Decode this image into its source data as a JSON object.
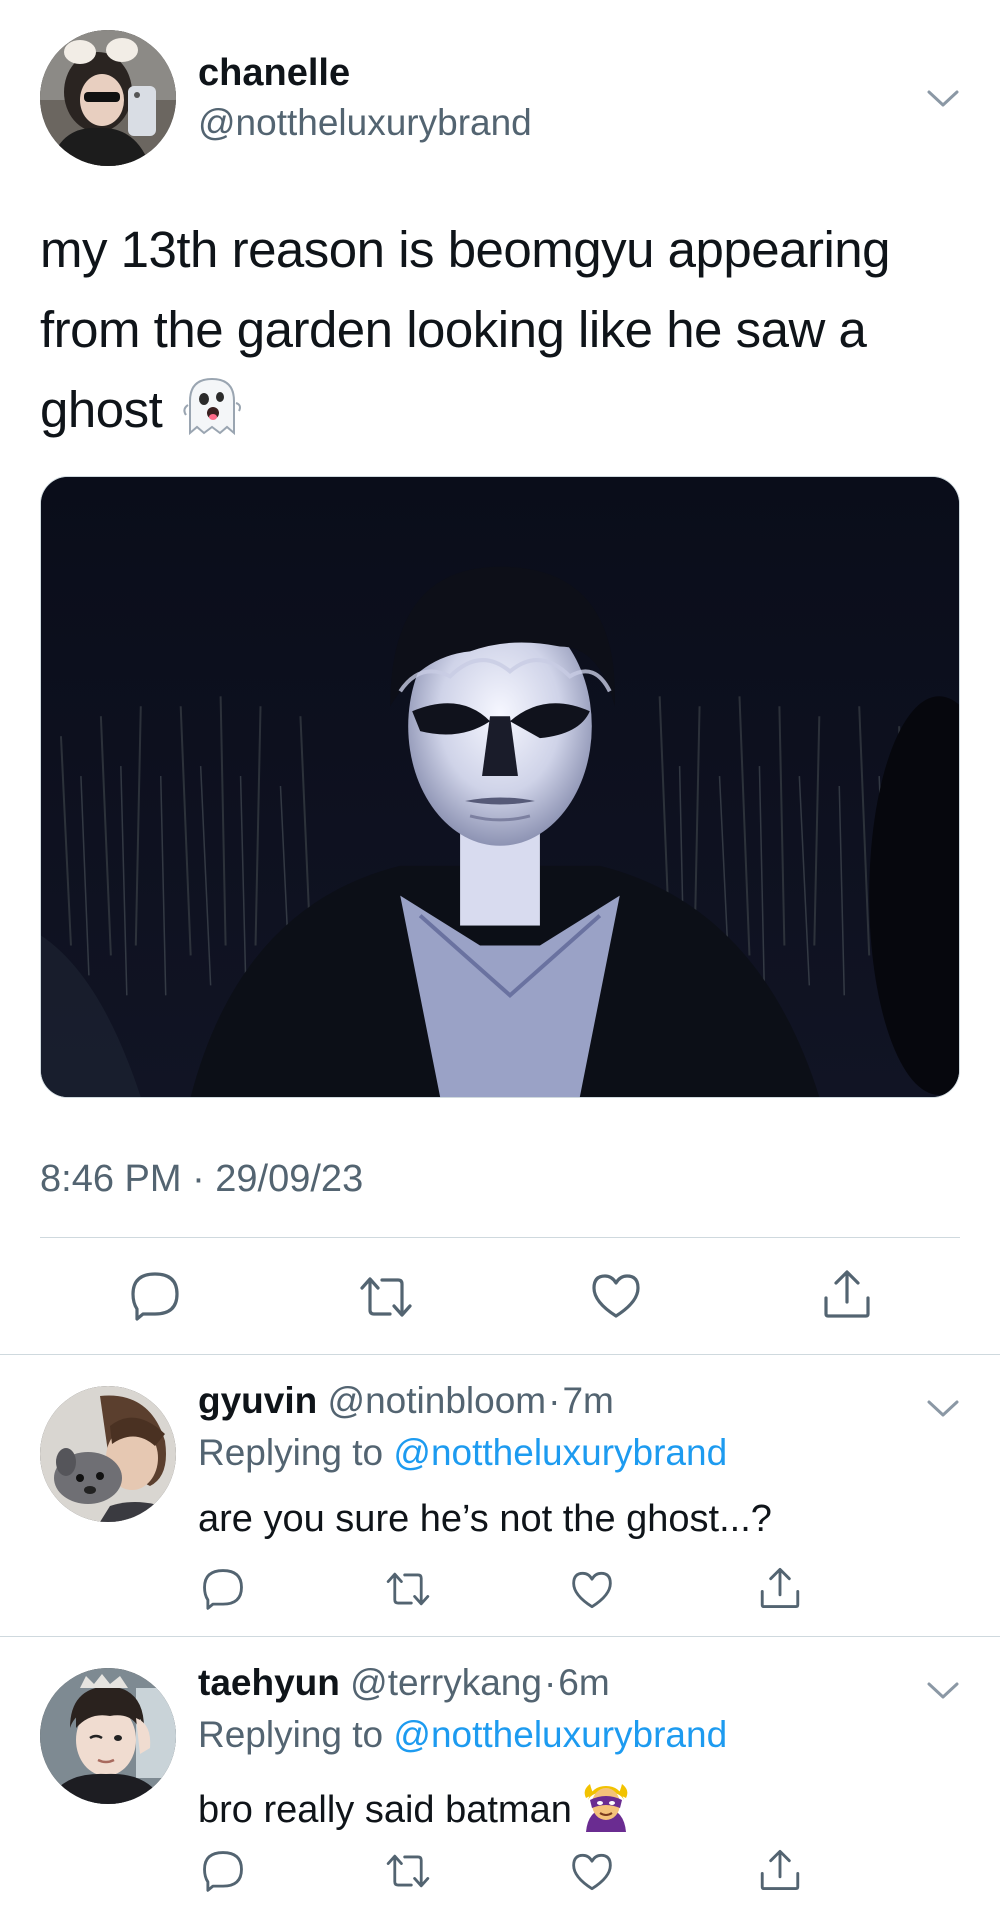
{
  "main_tweet": {
    "author_name": "chanelle",
    "author_handle": "@nottheluxurybrand",
    "text": "my 13th reason is beomgyu appearing from the garden looking like he saw a ghost",
    "emoji": "ghost-emoji",
    "timestamp": "8:46 PM · 29/09/23",
    "media": "image-of-person-lit-by-flashlight-in-dark-garden"
  },
  "replies": [
    {
      "author_name": "gyuvin",
      "author_handle": "@notinbloom",
      "separator": "·",
      "time": "7m",
      "replying_prefix": "Replying to ",
      "replying_to": "@nottheluxurybrand",
      "text": "are you sure he’s not the ghost...?"
    },
    {
      "author_name": "taehyun",
      "author_handle": "@terrykang",
      "separator": "·",
      "time": "6m",
      "replying_prefix": "Replying to ",
      "replying_to": "@nottheluxurybrand",
      "text": "bro really said batman",
      "emoji": "supervillain-emoji"
    }
  ],
  "actions": [
    "reply-icon",
    "retweet-icon",
    "like-icon",
    "share-icon"
  ],
  "colors": {
    "text": "#0f1419",
    "secondary": "#536471",
    "link": "#1d9bf0",
    "divider": "#cfd9de"
  }
}
